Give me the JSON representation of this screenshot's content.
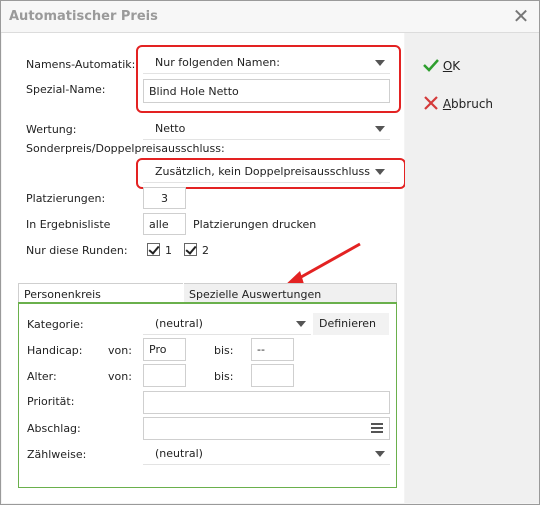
{
  "window": {
    "title": "Automatischer Preis"
  },
  "form": {
    "namens_automatik": {
      "label": "Namens-Automatik:",
      "value": "Nur folgenden Namen:"
    },
    "spezial_name": {
      "label": "Spezial-Name:",
      "value": "Blind Hole Netto"
    },
    "wertung": {
      "label": "Wertung:",
      "value": "Netto"
    },
    "sonderpreis": {
      "label": "Sonderpreis/Doppelpreisausschluss:",
      "value": "Zusätzlich, kein Doppelpreisausschluss"
    },
    "platzierungen": {
      "label": "Platzierungen:",
      "value": "3"
    },
    "ergebnisliste": {
      "label": "In Ergebnisliste",
      "value": "alle",
      "suffix": "Platzierungen drucken"
    },
    "runden": {
      "label": "Nur diese Runden:",
      "items": [
        {
          "label": "1",
          "checked": true
        },
        {
          "label": "2",
          "checked": true
        }
      ]
    }
  },
  "tabs": [
    {
      "label": "Personenkreis"
    },
    {
      "label": "Spezielle Auswertungen"
    }
  ],
  "panel": {
    "kategorie": {
      "label": "Kategorie:",
      "value": "(neutral)",
      "button": "Definieren"
    },
    "handicap": {
      "label": "Handicap:",
      "von_label": "von:",
      "von_value": "Pro",
      "bis_label": "bis:",
      "bis_value": "--"
    },
    "alter": {
      "label": "Alter:",
      "von_label": "von:",
      "von_value": "",
      "bis_label": "bis:",
      "bis_value": ""
    },
    "prioritaet": {
      "label": "Priorität:",
      "value": ""
    },
    "abschlag": {
      "label": "Abschlag:",
      "value": ""
    },
    "zaehlweise": {
      "label": "Zählweise:",
      "value": "(neutral)"
    }
  },
  "actions": {
    "ok": {
      "underlined": "O",
      "rest": "K",
      "color": "#2e9e2e"
    },
    "abbruch": {
      "underlined": "A",
      "rest": "bbruch",
      "color": "#d43a3a"
    }
  },
  "colors": {
    "highlight_frame": "#e32222",
    "tab_accent": "#6ab04c",
    "arrow": "#e32222"
  }
}
